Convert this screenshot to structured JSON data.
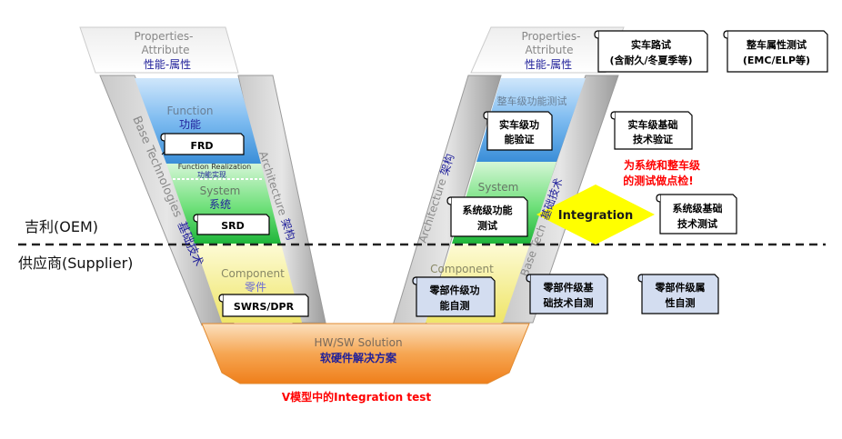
{
  "left_arm": {
    "properties_en": "Properties-",
    "properties_en2": "Attribute",
    "properties_cn": "性能-属性",
    "function_en": "Function",
    "function_cn": "功能",
    "frd": "FRD",
    "function_realization_en": "Function Realization",
    "function_realization_cn": "功能实现",
    "system_en": "System",
    "system_cn": "系统",
    "srd": "SRD",
    "component_en": "Component",
    "component_cn": "零件",
    "swrs": "SWRS/DPR",
    "base_tech_en": "Base Technologies",
    "base_tech_cn": "基础技术",
    "architecture_en": "Architecture",
    "architecture_cn": "架构"
  },
  "bottom": {
    "hw_sw_en": "HW/SW Solution",
    "hw_sw_cn": "软硬件解决方案",
    "caption": "V模型中的Integration test"
  },
  "right_arm": {
    "properties_en": "Properties-",
    "properties_en2": "Attribute",
    "properties_cn": "性能-属性",
    "vehicle_func_test": "整车级功能测试",
    "system_en": "System",
    "component_en": "Component",
    "architecture_en": "Architecture",
    "architecture_cn": "架构",
    "base_tech_en": "Base Tech",
    "base_tech_cn": "基础技术"
  },
  "scrolls": {
    "real_road_l1": "实车路试",
    "real_road_l2": "(含耐久/冬夏季等)",
    "vehicle_attr_l1": "整车属性测试",
    "vehicle_attr_l2": "(EMC/ELP等)",
    "vehicle_func_l1": "实车级功",
    "vehicle_func_l2": "能验证",
    "vehicle_base_l1": "实车级基础",
    "vehicle_base_l2": "技术验证",
    "system_func_l1": "系统级功能",
    "system_func_l2": "测试",
    "system_base_l1": "系统级基础",
    "system_base_l2": "技术测试",
    "part_func_l1": "零部件级功",
    "part_func_l2": "能自测",
    "part_base_l1": "零部件级基",
    "part_base_l2": "础技术自测",
    "part_attr_l1": "零部件级属",
    "part_attr_l2": "性自测"
  },
  "annotation": {
    "checkpoint_l1": "为系统和整车级",
    "checkpoint_l2": "的测试做点检!",
    "integration": "Integration"
  },
  "divider": {
    "oem_label": "吉利(OEM)",
    "supplier_label": "供应商(Supplier)"
  },
  "colors": {
    "blue_band": "#5aa3e0",
    "green_band": "#2fc54a",
    "yellow_band": "#f3ec7a",
    "orange_band": "#f39a3a",
    "gray_bar": "#a9a9a9",
    "diamond": "#ffff00",
    "red_text": "#ff0000",
    "navy_text": "#1f1f9a",
    "scroll_fill_white": "#ffffff",
    "scroll_fill_blue": "#d3ddf0"
  }
}
